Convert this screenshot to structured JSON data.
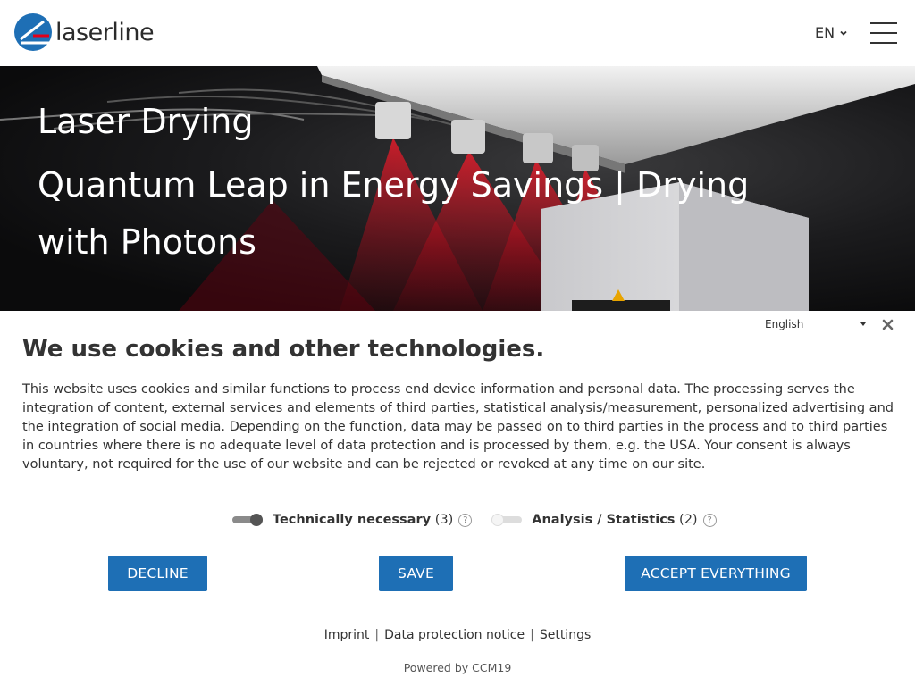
{
  "header": {
    "logo_text": "laserline",
    "language": "EN"
  },
  "hero": {
    "title": "Laser Drying",
    "subtitle": "Quantum Leap in Energy Savings | Drying with Photons"
  },
  "cookie": {
    "language_select": "English",
    "title": "We use cookies and other technologies.",
    "body": "This website uses cookies and similar functions to process end device information and personal data. The processing serves the integration of content, external services and elements of third parties, statistical analysis/measurement, personalized advertising and the integration of social media. Depending on the function, data may be passed on to third parties in the process and to third parties in countries where there is no adequate level of data protection and is processed by them, e.g. the USA. Your consent is always voluntary, not required for the use of our website and can be rejected or revoked at any time on our site.",
    "toggles": [
      {
        "label": "Technically necessary",
        "count": "(3)",
        "on": true
      },
      {
        "label": "Analysis / Statistics",
        "count": "(2)",
        "on": false
      }
    ],
    "help_glyph": "?",
    "buttons": {
      "decline": "DECLINE",
      "save": "SAVE",
      "accept": "ACCEPT EVERYTHING"
    },
    "links": [
      "Imprint",
      "Data protection notice",
      "Settings"
    ],
    "link_separator": "|",
    "powered_by": "Powered by CCM19"
  },
  "colors": {
    "accent": "#1e6fb5",
    "logo_blue": "#1e6fb5",
    "logo_red": "#e2001a"
  }
}
